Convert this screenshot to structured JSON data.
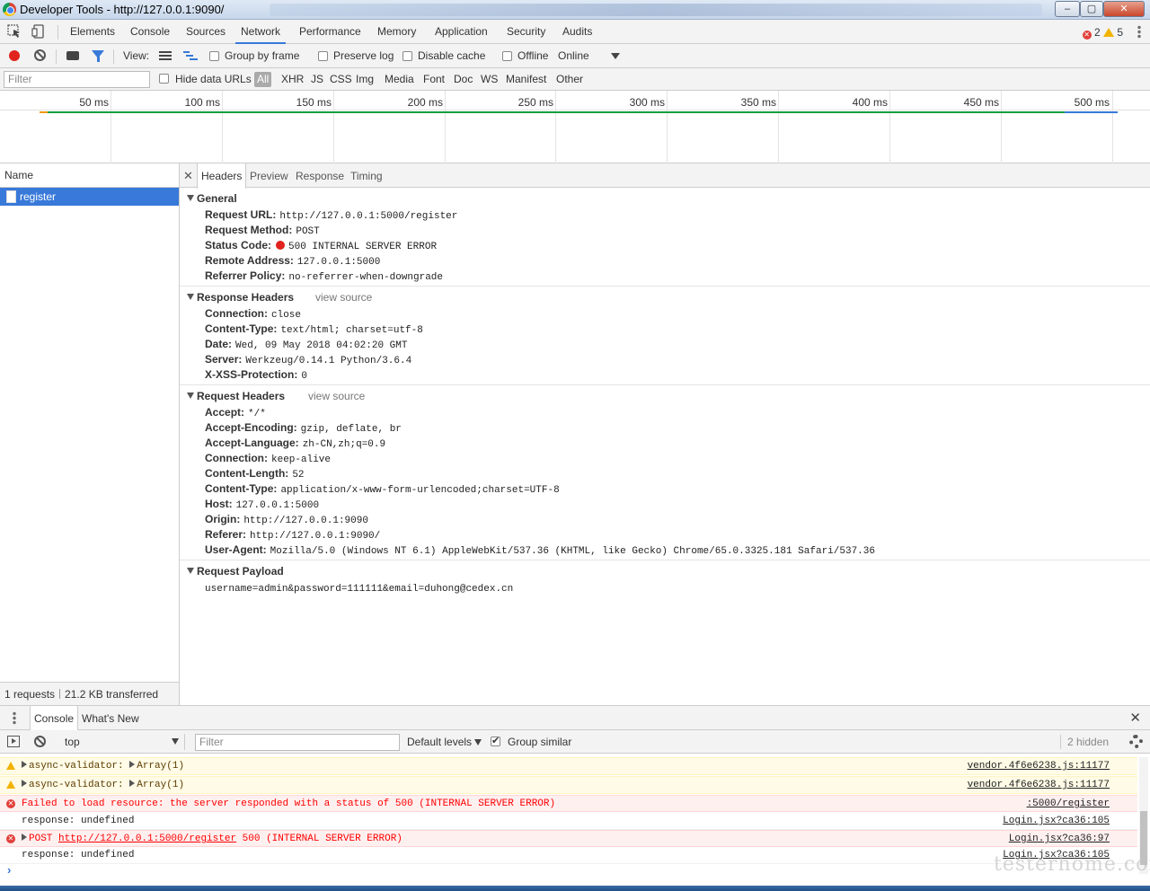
{
  "window": {
    "title": "Developer Tools - http://127.0.0.1:9090/"
  },
  "main_tabs": [
    "Elements",
    "Console",
    "Sources",
    "Network",
    "Performance",
    "Memory",
    "Application",
    "Security",
    "Audits"
  ],
  "active_tab": "Network",
  "issue_counts": {
    "errors": "2",
    "warnings": "5"
  },
  "network_toolbar": {
    "view_label": "View:",
    "group_by_frame": "Group by frame",
    "preserve_log": "Preserve log",
    "disable_cache": "Disable cache",
    "offline": "Offline",
    "throttling": "Online"
  },
  "filter_bar": {
    "placeholder": "Filter",
    "hide_data_urls": "Hide data URLs",
    "types": [
      "All",
      "XHR",
      "JS",
      "CSS",
      "Img",
      "Media",
      "Font",
      "Doc",
      "WS",
      "Manifest",
      "Other"
    ]
  },
  "timeline": {
    "ticks": [
      "50 ms",
      "100 ms",
      "150 ms",
      "200 ms",
      "250 ms",
      "300 ms",
      "350 ms",
      "400 ms",
      "450 ms",
      "500 ms"
    ]
  },
  "request_list": {
    "header": "Name",
    "items": [
      "register"
    ],
    "summary_requests": "1 requests",
    "summary_transferred": "21.2 KB transferred"
  },
  "detail_tabs": [
    "Headers",
    "Preview",
    "Response",
    "Timing"
  ],
  "general": {
    "title": "General",
    "rows": [
      {
        "key": "Request URL:",
        "value": "http://127.0.0.1:5000/register"
      },
      {
        "key": "Request Method:",
        "value": "POST"
      },
      {
        "key": "Status Code:",
        "value": "500 INTERNAL SERVER ERROR"
      },
      {
        "key": "Remote Address:",
        "value": "127.0.0.1:5000"
      },
      {
        "key": "Referrer Policy:",
        "value": "no-referrer-when-downgrade"
      }
    ]
  },
  "response_headers": {
    "title": "Response Headers",
    "view_source": "view source",
    "rows": [
      {
        "key": "Connection:",
        "value": "close"
      },
      {
        "key": "Content-Type:",
        "value": "text/html; charset=utf-8"
      },
      {
        "key": "Date:",
        "value": "Wed, 09 May 2018 04:02:20 GMT"
      },
      {
        "key": "Server:",
        "value": "Werkzeug/0.14.1 Python/3.6.4"
      },
      {
        "key": "X-XSS-Protection:",
        "value": "0"
      }
    ]
  },
  "request_headers": {
    "title": "Request Headers",
    "view_source": "view source",
    "rows": [
      {
        "key": "Accept:",
        "value": "*/*"
      },
      {
        "key": "Accept-Encoding:",
        "value": "gzip, deflate, br"
      },
      {
        "key": "Accept-Language:",
        "value": "zh-CN,zh;q=0.9"
      },
      {
        "key": "Connection:",
        "value": "keep-alive"
      },
      {
        "key": "Content-Length:",
        "value": "52"
      },
      {
        "key": "Content-Type:",
        "value": "application/x-www-form-urlencoded;charset=UTF-8"
      },
      {
        "key": "Host:",
        "value": "127.0.0.1:5000"
      },
      {
        "key": "Origin:",
        "value": "http://127.0.0.1:9090"
      },
      {
        "key": "Referer:",
        "value": "http://127.0.0.1:9090/"
      },
      {
        "key": "User-Agent:",
        "value": "Mozilla/5.0 (Windows NT 6.1) AppleWebKit/537.36 (KHTML, like Gecko) Chrome/65.0.3325.181 Safari/537.36"
      }
    ]
  },
  "request_payload": {
    "title": "Request Payload",
    "body": "username=admin&password=111111&email=duhong@cedex.cn"
  },
  "drawer": {
    "tabs": [
      "Console",
      "What's New"
    ],
    "context": "top",
    "filter_placeholder": "Filter",
    "levels": "Default levels",
    "group_similar": "Group similar",
    "hidden": "2 hidden",
    "messages": [
      {
        "level": "warn",
        "text_prefix": "async-validator:",
        "text_suffix": "Array(1)",
        "source": "vendor.4f6e6238.js:11177"
      },
      {
        "level": "warn",
        "text_prefix": "async-validator:",
        "text_suffix": "Array(1)",
        "source": "vendor.4f6e6238.js:11177"
      },
      {
        "level": "error",
        "text": "Failed to load resource: the server responded with a status of 500 (INTERNAL SERVER ERROR)",
        "source": ":5000/register"
      },
      {
        "level": "log",
        "text": "response: undefined",
        "source": "Login.jsx?ca36:105"
      },
      {
        "level": "error",
        "text_prefix": "POST",
        "link": "http://127.0.0.1:5000/register",
        "text_suffix": "500 (INTERNAL SERVER ERROR)",
        "source": "Login.jsx?ca36:97"
      },
      {
        "level": "log",
        "text": "response: undefined",
        "source": "Login.jsx?ca36:105"
      }
    ]
  },
  "watermark": "testerhome.com",
  "colors": {
    "accent": "#3879d9",
    "error": "#e0231c",
    "warning": "#f2b300"
  }
}
